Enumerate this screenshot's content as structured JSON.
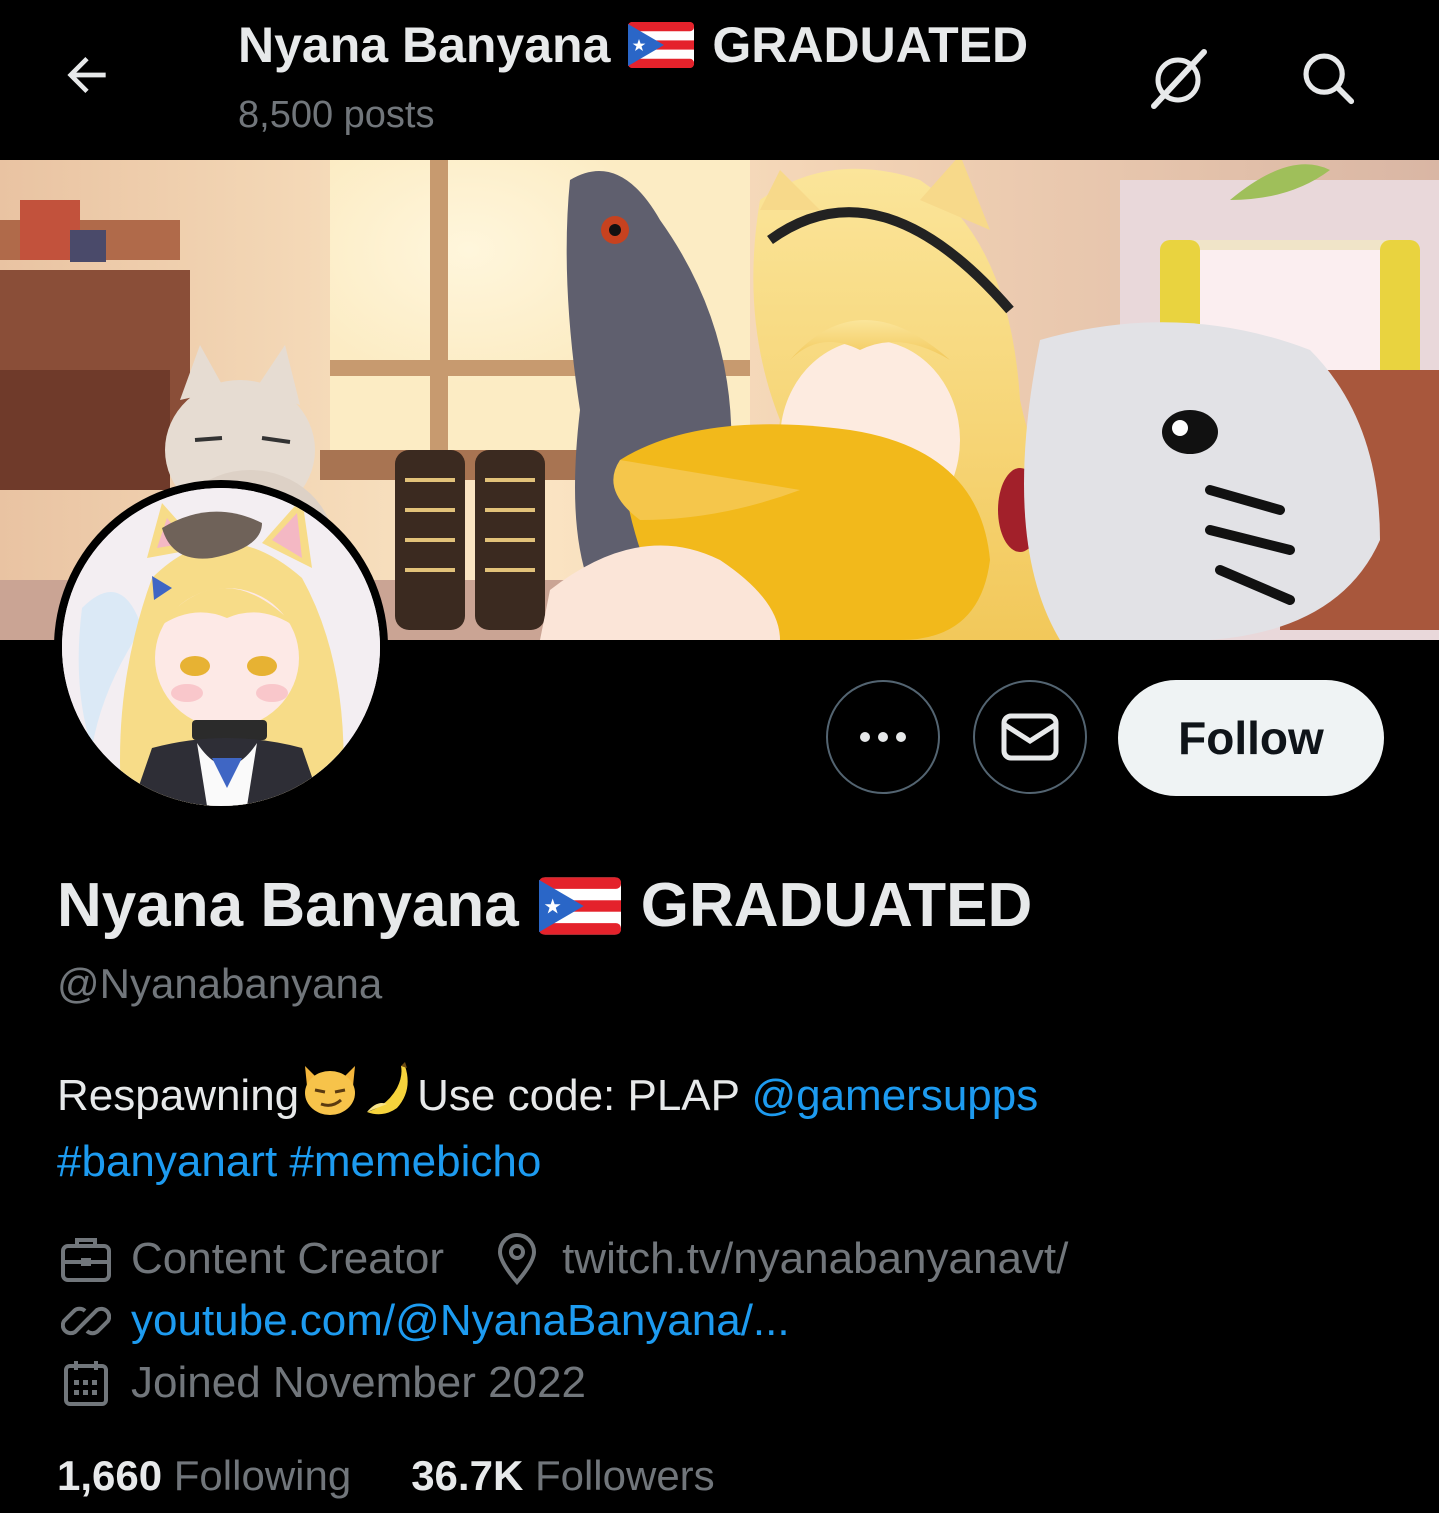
{
  "header": {
    "name": "Nyana Banyana",
    "name_suffix": "GRADUATED",
    "post_count": "8,500 posts"
  },
  "profile": {
    "display_name": "Nyana Banyana",
    "display_suffix": "GRADUATED",
    "handle": "@Nyanabanyana",
    "follow_label": "Follow",
    "bio": {
      "text_1": "Respawning",
      "text_2": "Use code: PLAP ",
      "mention": "@gamersupps",
      "hashtag_1": "#banyanart",
      "hashtag_2": "#memebicho"
    },
    "category": "Content Creator",
    "location": "twitch.tv/nyanabanyanavt/",
    "website": "youtube.com/@NyanaBanyana/...",
    "joined": "Joined November 2022",
    "following_count": "1,660",
    "following_label": "Following",
    "followers_count": "36.7K",
    "followers_label": "Followers"
  },
  "icons": {
    "back": "arrow-left-icon",
    "grok": "grok-icon",
    "search": "search-icon",
    "more": "more-icon",
    "message": "envelope-icon",
    "category": "briefcase-icon",
    "location": "location-pin-icon",
    "website": "link-icon",
    "joined": "calendar-icon"
  },
  "colors": {
    "background": "#000000",
    "text_primary": "#e7e9ea",
    "text_secondary": "#71767b",
    "link": "#1d9bf0",
    "follow_bg": "#eff3f4",
    "border": "#536471"
  }
}
